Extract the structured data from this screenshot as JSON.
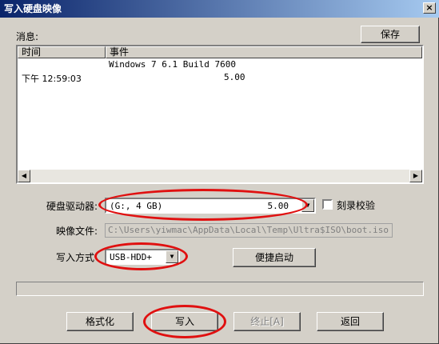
{
  "window": {
    "title": "写入硬盘映像",
    "close_glyph": "×"
  },
  "messages": {
    "label": "消息:",
    "save_label": "保存",
    "columns": [
      "时间",
      "事件"
    ],
    "rows": [
      {
        "time": "",
        "event": "Windows 7 6.1 Build 7600"
      },
      {
        "time": "下午 12:59:03",
        "event": "5.00"
      }
    ]
  },
  "drive": {
    "label": "硬盘驱动器:",
    "selected": "(G:, 4 GB)",
    "size": "5.00",
    "verify_label": "刻录校验",
    "verify_checked": false
  },
  "image_file": {
    "label": "映像文件:",
    "value": "C:\\Users\\yiwmac\\AppData\\Local\\Temp\\Ultra$ISO\\boot.iso"
  },
  "write_method": {
    "label": "写入方式",
    "selected": "USB-HDD+",
    "boot_button": "便捷启动"
  },
  "progress": {
    "value": 0
  },
  "buttons": {
    "format": "格式化",
    "write": "写入",
    "stop": "终止[A]",
    "back": "返回"
  },
  "icons": {
    "dropdown": "chevron-down-icon",
    "scroll_left": "arrow-left-icon",
    "scroll_right": "arrow-right-icon"
  },
  "colors": {
    "annotation": "#e01010",
    "title_start": "#0a246a",
    "title_end": "#a6caf0"
  }
}
